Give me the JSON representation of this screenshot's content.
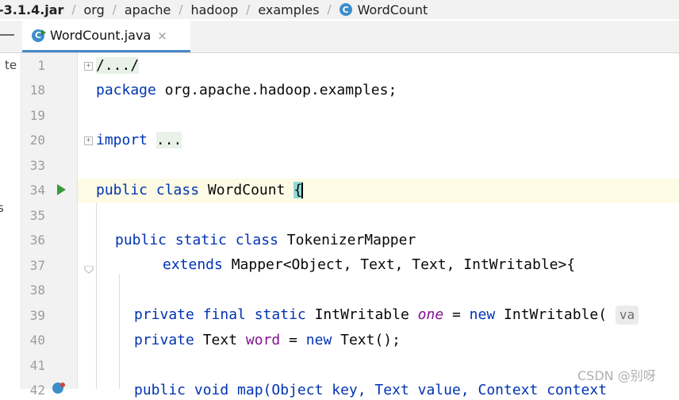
{
  "breadcrumb": {
    "items": [
      "-3.1.4.jar",
      "org",
      "apache",
      "hadoop",
      "examples",
      "WordCount"
    ],
    "class_icon_letter": "C"
  },
  "tabs": [
    {
      "label": "WordCount.java",
      "close": "×",
      "icon_letter": "C"
    }
  ],
  "sidebar": {
    "fragment1": "te",
    "fragment2": "s"
  },
  "editor": {
    "lines": [
      {
        "num": "1"
      },
      {
        "num": "18"
      },
      {
        "num": "19"
      },
      {
        "num": "20"
      },
      {
        "num": "33"
      },
      {
        "num": "34"
      },
      {
        "num": "35"
      },
      {
        "num": "36"
      },
      {
        "num": "37"
      },
      {
        "num": "38"
      },
      {
        "num": "39"
      },
      {
        "num": "40"
      },
      {
        "num": "41"
      },
      {
        "num": "42"
      }
    ],
    "code": {
      "l1_fold": "/.../",
      "l18_kw": "package",
      "l18_rest": " org.apache.hadoop.examples;",
      "l20_kw": "import",
      "l20_fold": "...",
      "l34_kw": "public class",
      "l34_name": " WordCount ",
      "l34_brace": "{",
      "l36_kw": "public static class",
      "l36_name": " TokenizerMapper",
      "l37_kw": "extends",
      "l37_rest": " Mapper<Object, Text, Text, IntWritable>{",
      "l39_kw": "private final static",
      "l39_type": " IntWritable ",
      "l39_field": "one",
      "l39_eq": " = ",
      "l39_new": "new",
      "l39_ctor": " IntWritable(",
      "l39_hint": "va",
      "l40_kw": "private",
      "l40_type": " Text ",
      "l40_field": "word",
      "l40_eq": " = ",
      "l40_new": "new",
      "l40_ctor": " Text();",
      "l42_partial": "public void map(Object key, Text value, Context context"
    }
  },
  "watermark": "CSDN @别呀",
  "colors": {
    "keyword": "#0033b3",
    "field": "#871094",
    "gutter": "#f2f2f2",
    "caret_line": "#fdfbe5",
    "accent": "#4a88c7"
  }
}
